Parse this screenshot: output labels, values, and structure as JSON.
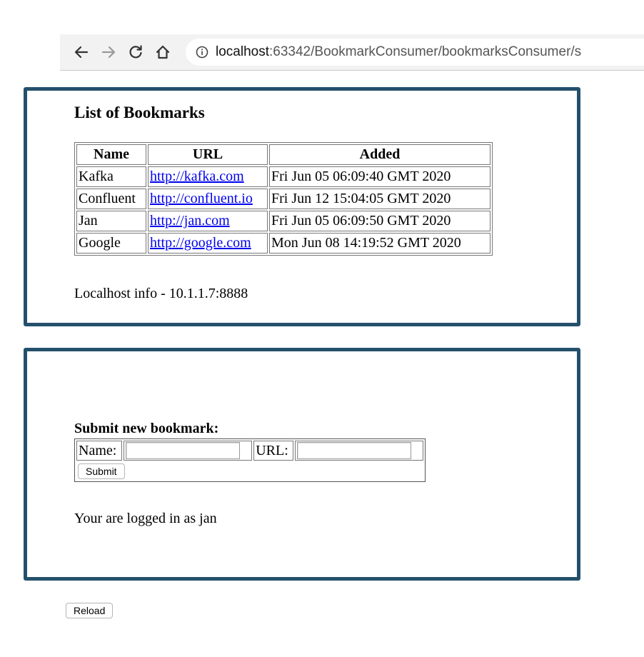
{
  "browser": {
    "url_host": "localhost",
    "url_rest": ":63342/BookmarkConsumer/bookmarksConsumer/s"
  },
  "bookmarks": {
    "title": "List of Bookmarks",
    "headers": {
      "name": "Name",
      "url": "URL",
      "added": "Added"
    },
    "rows": [
      {
        "name": "Kafka",
        "url": "http://kafka.com",
        "added": "Fri Jun 05 06:09:40 GMT 2020"
      },
      {
        "name": "Confluent",
        "url": "http://confluent.io",
        "added": "Fri Jun 12 15:04:05 GMT 2020"
      },
      {
        "name": "Jan",
        "url": "http://jan.com",
        "added": "Fri Jun 05 06:09:50 GMT 2020"
      },
      {
        "name": "Google",
        "url": "http://google.com",
        "added": "Mon Jun 08 14:19:52 GMT 2020"
      }
    ],
    "info": "Localhost info - 10.1.1.7:8888"
  },
  "form": {
    "title": "Submit new bookmark:",
    "name_label": "Name:",
    "name_value": "",
    "url_label": "URL:",
    "url_value": "",
    "submit_label": "Submit",
    "logged_in": "Your are logged in as jan"
  },
  "reload_label": "Reload",
  "colors": {
    "frame": "#24506c",
    "link": "#0000ee"
  },
  "icons": [
    "back-arrow-icon",
    "forward-arrow-icon",
    "reload-icon",
    "home-icon",
    "info-icon"
  ]
}
